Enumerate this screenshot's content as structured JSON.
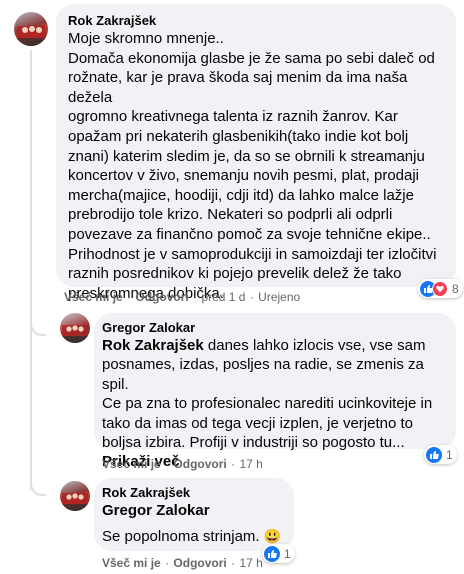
{
  "comments": [
    {
      "author": "Rok Zakrajšek",
      "text": "Moje skromno mnenje..\nDomača ekonomija glasbe je že sama po sebi daleč od\nrožnate, kar je prava škoda saj menim da ima naša dežela\nogromno kreativnega talenta iz raznih žanrov. Kar\nopažam pri nekaterih glasbenikih(tako indie kot bolj\nznani) katerim sledim je, da so se obrnili k streamanju\nkoncertov v živo, snemanju novih pesmi, plat, prodaji\nmercha(majice, hoodiji, cdji itd) da lahko malce lažje\nprebrodijo tole krizo. Nekateri so podprli ali odprli\npovezave za finančno pomoč za svoje tehnične ekipe..\nPrihodnost je v samoprodukciji in samoizdaji ter izločitvi\nraznih posrednikov ki pojejo prevelik delež že tako\npreskromnega dobička.",
      "like_label": "Všeč mi je",
      "reply_label": "Odgovori",
      "time": "pred 1 d",
      "edited": "Urejeno",
      "reaction_count": "8"
    },
    {
      "author": "Gregor Zalokar",
      "mention": "Rok Zakrajšek",
      "text": " danes lahko izlocis vse, vse sam\nposnames, izdas, posljes na radie, se zmenis za spil.\nCe pa zna to profesionalec narediti ucinkoviteje in\ntako da imas od tega vecji izplen, je verjetno to\nboljsa izbira. Profiji v industriji so pogosto tu...",
      "see_more": "Prikaži več",
      "like_label": "Všeč mi je",
      "reply_label": "Odgovori",
      "time": "17 h",
      "reaction_count": "1"
    },
    {
      "author": "Rok Zakrajšek",
      "mention": "Gregor Zalokar",
      "text": "Se popolnoma strinjam. ",
      "emoji": "😃",
      "like_label": "Všeč mi je",
      "reply_label": "Odgovori",
      "time": "17 h",
      "reaction_count": "1"
    }
  ],
  "colors": {
    "bubble": "#f0f2f5",
    "like_blue": "#1877f2",
    "heart_red": "#f33e58",
    "meta_gray": "#65676b"
  },
  "icons": {
    "like": "like-icon",
    "heart": "heart-icon"
  }
}
